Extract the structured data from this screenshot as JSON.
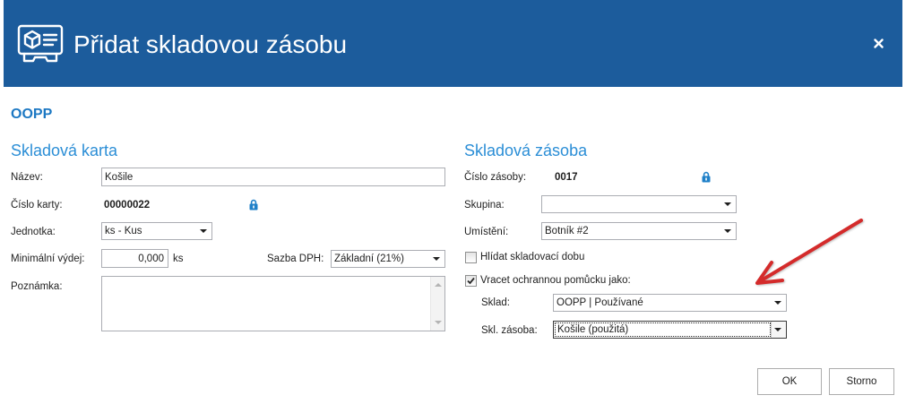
{
  "window": {
    "title": "Přidat skladovou zásobu",
    "icon": "stock-card-icon",
    "close_icon": "close-icon"
  },
  "context": {
    "title": "OOPP"
  },
  "card": {
    "section_title": "Skladová karta",
    "name": {
      "label": "Název:",
      "value": "Košile"
    },
    "card_number": {
      "label": "Číslo karty:",
      "value": "00000022",
      "icon": "lock-icon"
    },
    "unit": {
      "label": "Jednotka:",
      "value": "ks - Kus"
    },
    "min_issue": {
      "label": "Minimální výdej:",
      "value": "0,000",
      "unit": "ks"
    },
    "vat_rate": {
      "label": "Sazba DPH:",
      "value": "Základní (21%)"
    },
    "note": {
      "label": "Poznámka:",
      "value": ""
    }
  },
  "stock": {
    "section_title": "Skladová zásoba",
    "stock_number": {
      "label": "Číslo zásoby:",
      "value": "0017",
      "icon": "lock-icon"
    },
    "group": {
      "label": "Skupina:",
      "value": ""
    },
    "location": {
      "label": "Umístění:",
      "value": "Botník #2"
    },
    "watch_storage_period": {
      "label": "Hlídat skladovací dobu",
      "checked": false
    },
    "return_as": {
      "label": "Vracet ochrannou pomůcku jako:",
      "checked": true
    },
    "warehouse": {
      "label": "Sklad:",
      "value": "OOPP | Používané"
    },
    "stock_item": {
      "label": "Skl. zásoba:",
      "value": "Košile (použitá)"
    }
  },
  "buttons": {
    "ok": "OK",
    "cancel": "Storno"
  },
  "colors": {
    "header_bg": "#1c5c9c",
    "context_title": "#1c78c3",
    "section_title": "#2b8ed6",
    "lock": "#1f80c8",
    "annotation": "#d42b2b"
  }
}
